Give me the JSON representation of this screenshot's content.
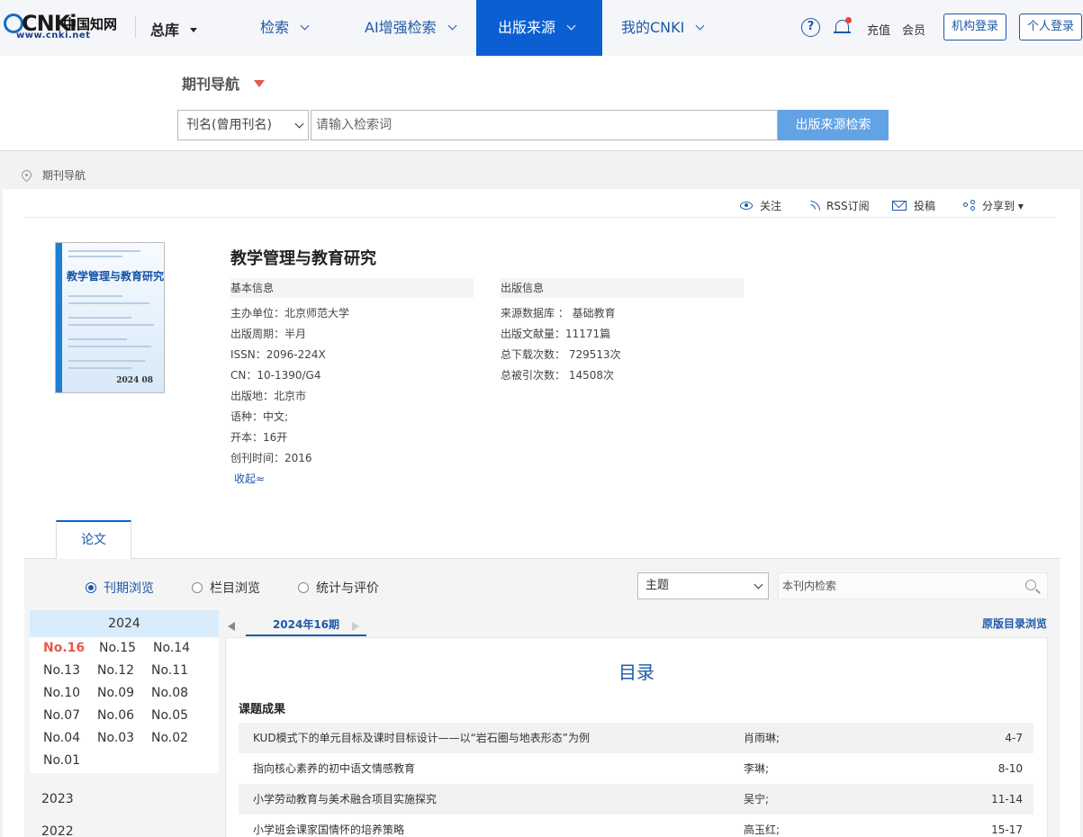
{
  "topbar": {
    "logo_text": "CNKi",
    "logo_cn": "中国知网",
    "logo_url": "www.cnki.net",
    "library": "总库",
    "nav": [
      {
        "label": "检索"
      },
      {
        "label": "AI增强检索"
      },
      {
        "label": "出版来源"
      },
      {
        "label": "我的CNKI"
      }
    ],
    "help_icon": "?",
    "recharge": "充值",
    "member": "会员",
    "org_login": "机构登录",
    "personal_login": "个人登录"
  },
  "search": {
    "nav_title": "期刊导航",
    "field": "刊名(曾用刊名)",
    "placeholder": "请输入检索词",
    "button": "出版来源检索"
  },
  "breadcrumb": "期刊导航",
  "actions": {
    "follow": "关注",
    "rss": "RSS订阅",
    "submit": "投稿",
    "share": "分享到 ▾"
  },
  "cover": {
    "title": "教学管理与教育研究",
    "issue": "2024 08"
  },
  "journal": {
    "title": "教学管理与教育研究",
    "basic_header": "基本信息",
    "publish_header": "出版信息",
    "basic": [
      "主办单位：北京师范大学",
      "出版周期：半月",
      "ISSN：2096-224X",
      "CN：10-1390/G4",
      "出版地：北京市",
      "语种：中文;",
      "开本：16开",
      "创刊时间：2016"
    ],
    "publish": [
      "来源数据库 ： 基础教育",
      "出版文献量：11171篇",
      "总下载次数： 729513次",
      "总被引次数： 14508次"
    ],
    "collapse": "收起≈"
  },
  "tabs": {
    "papers": "论文"
  },
  "browse": {
    "options": [
      "刊期浏览",
      "栏目浏览",
      "统计与评价"
    ],
    "topic": "主题",
    "in_search_placeholder": "本刊内检索"
  },
  "years": {
    "current": "2024",
    "issues": [
      "No.16",
      "No.15",
      "No.14",
      "No.13",
      "No.12",
      "No.11",
      "No.10",
      "No.09",
      "No.08",
      "No.07",
      "No.06",
      "No.05",
      "No.04",
      "No.03",
      "No.02",
      "No.01"
    ],
    "others": [
      "2023",
      "2022"
    ]
  },
  "catalog": {
    "issue_label": "2024年16期",
    "raw_view": "原版目录浏览",
    "heading": "目录",
    "section": "课题成果",
    "rows": [
      {
        "title": "KUD模式下的单元目标及课时目标设计——以“岩石圈与地表形态”为例",
        "author": "肖雨琳;",
        "pages": "4-7"
      },
      {
        "title": "指向核心素养的初中语文情感教育",
        "author": "李琳;",
        "pages": "8-10"
      },
      {
        "title": "小学劳动教育与美术融合项目实施探究",
        "author": "吴宁;",
        "pages": "11-14"
      },
      {
        "title": "小学班会课家国情怀的培养策略",
        "author": "高玉红;",
        "pages": "15-17"
      }
    ]
  }
}
